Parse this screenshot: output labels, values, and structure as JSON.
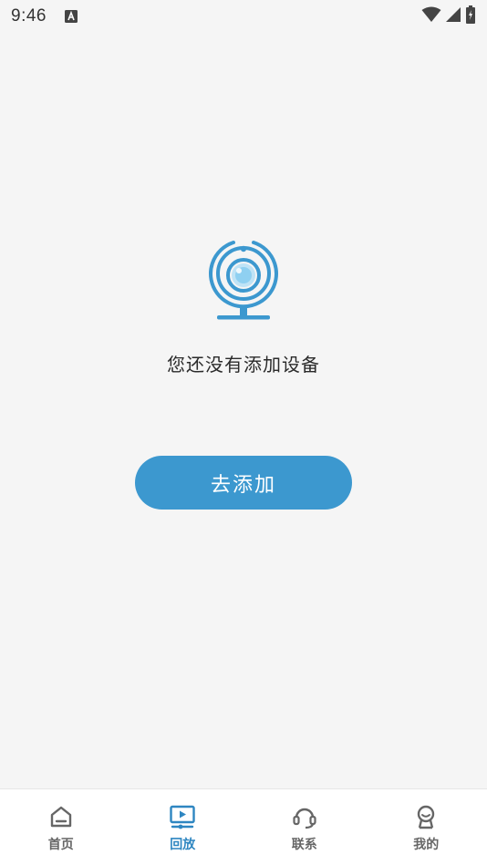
{
  "status_bar": {
    "time": "9:46",
    "notification_icon": "a-icon",
    "icons": [
      "wifi-icon",
      "signal-icon",
      "battery-icon"
    ]
  },
  "empty_state": {
    "icon": "webcam-icon",
    "message": "您还没有添加设备",
    "button_label": "去添加"
  },
  "bottom_nav": {
    "items": [
      {
        "label": "首页",
        "icon": "home-icon",
        "active": false
      },
      {
        "label": "回放",
        "icon": "playback-icon",
        "active": true
      },
      {
        "label": "联系",
        "icon": "headset-icon",
        "active": false
      },
      {
        "label": "我的",
        "icon": "profile-icon",
        "active": false
      }
    ]
  },
  "colors": {
    "accent": "#3c98cf",
    "active_nav": "#2e86c1",
    "background": "#f5f5f5"
  }
}
